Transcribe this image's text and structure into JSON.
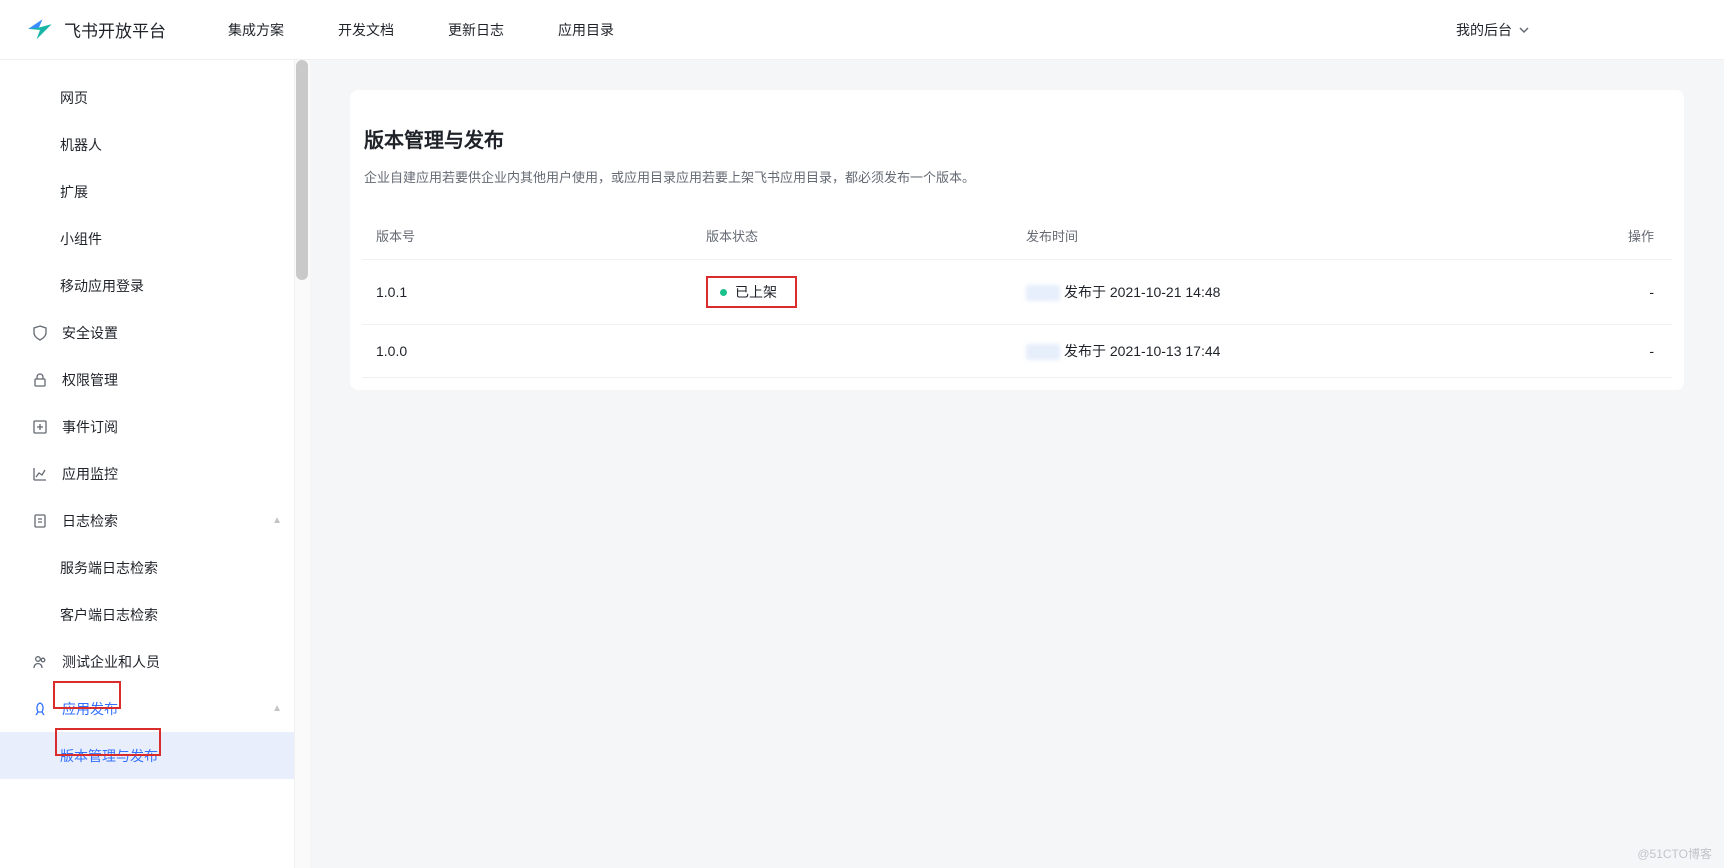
{
  "brand": "飞书开放平台",
  "nav": [
    "集成方案",
    "开发文档",
    "更新日志",
    "应用目录"
  ],
  "header_right": "我的后台",
  "sidebar": {
    "items": [
      {
        "label": "网页",
        "sub": true
      },
      {
        "label": "机器人",
        "sub": true
      },
      {
        "label": "扩展",
        "sub": true
      },
      {
        "label": "小组件",
        "sub": true
      },
      {
        "label": "移动应用登录",
        "sub": true
      },
      {
        "label": "安全设置",
        "icon": "shield"
      },
      {
        "label": "权限管理",
        "icon": "lock"
      },
      {
        "label": "事件订阅",
        "icon": "plus-square"
      },
      {
        "label": "应用监控",
        "icon": "chart"
      },
      {
        "label": "日志检索",
        "icon": "doc",
        "caret": true
      },
      {
        "label": "服务端日志检索",
        "sub": true
      },
      {
        "label": "客户端日志检索",
        "sub": true
      },
      {
        "label": "测试企业和人员",
        "icon": "people"
      },
      {
        "label": "应用发布",
        "icon": "rocket",
        "active": true,
        "caret": true,
        "hl": "hl1"
      },
      {
        "label": "版本管理与发布",
        "sub": true,
        "selected": true,
        "hl": "hl2"
      }
    ]
  },
  "panel": {
    "title": "版本管理与发布",
    "desc": "企业自建应用若要供企业内其他用户使用，或应用目录应用若要上架飞书应用目录，都必须发布一个版本。",
    "columns": [
      "版本号",
      "版本状态",
      "发布时间",
      "操作"
    ],
    "rows": [
      {
        "version": "1.0.1",
        "status": "已上架",
        "status_hl": true,
        "time": "发布于 2021-10-21 14:48",
        "op": "-"
      },
      {
        "version": "1.0.0",
        "status": "",
        "time": "发布于 2021-10-13 17:44",
        "op": "-"
      }
    ]
  },
  "watermark": "@51CTO博客"
}
